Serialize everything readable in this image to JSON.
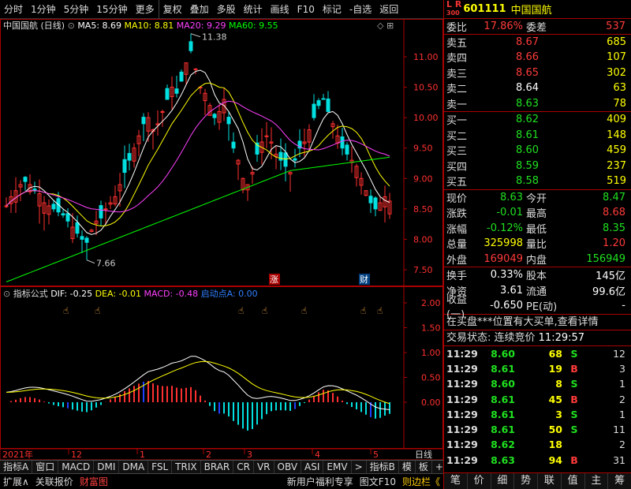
{
  "toolbar": {
    "items": [
      "分时",
      "1分钟",
      "5分钟",
      "15分钟",
      "更多",
      "复权",
      "叠加",
      "多股",
      "统计",
      "画线",
      "F10",
      "标记",
      "-自选",
      "返回"
    ]
  },
  "kline": {
    "title": "中国国航 (日线)",
    "ma5": "MA5: 8.69",
    "ma10": "MA10: 8.81",
    "ma20": "MA20: 9.29",
    "ma60": "MA60: 9.55",
    "high_label": "11.38",
    "low_label": "7.66",
    "zhang": "涨",
    "cai": "财",
    "price_ticks": [
      "11.00",
      "10.50",
      "10.00",
      "9.50",
      "9.00",
      "8.50",
      "8.00",
      "7.50"
    ],
    "colors": {
      "up": "#ff3030",
      "down": "#00e0e0",
      "ma5": "#ffffff",
      "ma10": "#ffff00",
      "ma20": "#ff40ff",
      "ma60": "#00ff00"
    }
  },
  "macd": {
    "title": "指标公式",
    "dif": "DIF: -0.25",
    "dea": "DEA: -0.01",
    "macd": "MACD: -0.48",
    "qd": "启动点A: 0.00",
    "ticks": [
      "2.00",
      "1.50",
      "1.00",
      "0.50",
      "0.00"
    ]
  },
  "date_axis": {
    "year": "2021年",
    "months": [
      "12",
      "1",
      "2",
      "3",
      "4",
      "5"
    ],
    "period": "日线"
  },
  "tabs1": [
    "指标A",
    "窗口",
    "MACD",
    "DMI",
    "DMA",
    "FSL",
    "TRIX",
    "BRAR",
    "CR",
    "VR",
    "OBV",
    "ASI",
    "EMV",
    ">",
    "指标B",
    "模",
    "板",
    "+",
    "-"
  ],
  "tabs2": {
    "left": [
      "扩展∧",
      "关联报价",
      "财富图"
    ],
    "right": [
      "新用户福利专享",
      "图文F10",
      "则边栏《"
    ]
  },
  "quote": {
    "code": "601111",
    "name": "中国国航",
    "lr": "L R",
    "lr_num": "300",
    "wb": "委比",
    "wb_val": "17.86%",
    "wc": "委差",
    "wc_val": "537",
    "asks": [
      {
        "l": "卖五",
        "p": "8.67",
        "v": "685",
        "c": "red"
      },
      {
        "l": "卖四",
        "p": "8.66",
        "v": "107",
        "c": "red"
      },
      {
        "l": "卖三",
        "p": "8.65",
        "v": "302",
        "c": "red"
      },
      {
        "l": "卖二",
        "p": "8.64",
        "v": "63",
        "c": "wht"
      },
      {
        "l": "卖一",
        "p": "8.63",
        "v": "78",
        "c": "grn"
      }
    ],
    "bids": [
      {
        "l": "买一",
        "p": "8.62",
        "v": "409",
        "c": "grn"
      },
      {
        "l": "买二",
        "p": "8.61",
        "v": "148",
        "c": "grn"
      },
      {
        "l": "买三",
        "p": "8.60",
        "v": "459",
        "c": "grn"
      },
      {
        "l": "买四",
        "p": "8.59",
        "v": "237",
        "c": "grn"
      },
      {
        "l": "买五",
        "p": "8.58",
        "v": "519",
        "c": "grn"
      }
    ],
    "stats1": [
      {
        "a": "现价",
        "b": "8.63",
        "bc": "grn",
        "c": "今开",
        "d": "8.47",
        "dc": "grn"
      },
      {
        "a": "涨跌",
        "b": "-0.01",
        "bc": "grn",
        "c": "最高",
        "d": "8.68",
        "dc": "red"
      },
      {
        "a": "涨幅",
        "b": "-0.12%",
        "bc": "grn",
        "c": "最低",
        "d": "8.35",
        "dc": "grn"
      },
      {
        "a": "总量",
        "b": "325998",
        "bc": "yel",
        "c": "量比",
        "d": "1.20",
        "dc": "red"
      },
      {
        "a": "外盘",
        "b": "169049",
        "bc": "red",
        "c": "内盘",
        "d": "156949",
        "dc": "grn"
      }
    ],
    "stats2": [
      {
        "a": "换手",
        "b": "0.33%",
        "bc": "wht",
        "c": "股本",
        "d": "145亿",
        "dc": "wht"
      },
      {
        "a": "净资",
        "b": "3.61",
        "bc": "wht",
        "c": "流通",
        "d": "99.6亿",
        "dc": "wht"
      },
      {
        "a": "收益(一)",
        "b": "-0.650",
        "bc": "wht",
        "c": "PE(动)",
        "d": "-",
        "dc": "wht"
      }
    ],
    "msg1": "在买盘***位置有大买单,查看详情",
    "msg2_label": "交易状态: 连续竞价",
    "msg2_time": "11:29:57",
    "ticks": [
      {
        "t": "11:29",
        "p": "8.60",
        "pc": "grn",
        "q": "68",
        "d": "S",
        "dc": "grn",
        "n": "12"
      },
      {
        "t": "11:29",
        "p": "8.61",
        "pc": "grn",
        "q": "19",
        "d": "B",
        "dc": "red",
        "n": "3"
      },
      {
        "t": "11:29",
        "p": "8.60",
        "pc": "grn",
        "q": "8",
        "d": "S",
        "dc": "grn",
        "n": "1"
      },
      {
        "t": "11:29",
        "p": "8.61",
        "pc": "grn",
        "q": "45",
        "d": "B",
        "dc": "red",
        "n": "2"
      },
      {
        "t": "11:29",
        "p": "8.61",
        "pc": "grn",
        "q": "3",
        "d": "S",
        "dc": "grn",
        "n": "1"
      },
      {
        "t": "11:29",
        "p": "8.61",
        "pc": "grn",
        "q": "50",
        "d": "S",
        "dc": "grn",
        "n": "11"
      },
      {
        "t": "11:29",
        "p": "8.62",
        "pc": "grn",
        "q": "18",
        "d": "",
        "dc": "wht",
        "n": "2"
      },
      {
        "t": "11:29",
        "p": "8.63",
        "pc": "grn",
        "q": "94",
        "d": "B",
        "dc": "red",
        "n": "31"
      }
    ],
    "bottom_tabs": [
      "笔",
      "价",
      "细",
      "势",
      "联",
      "值",
      "主",
      "筹"
    ]
  }
}
